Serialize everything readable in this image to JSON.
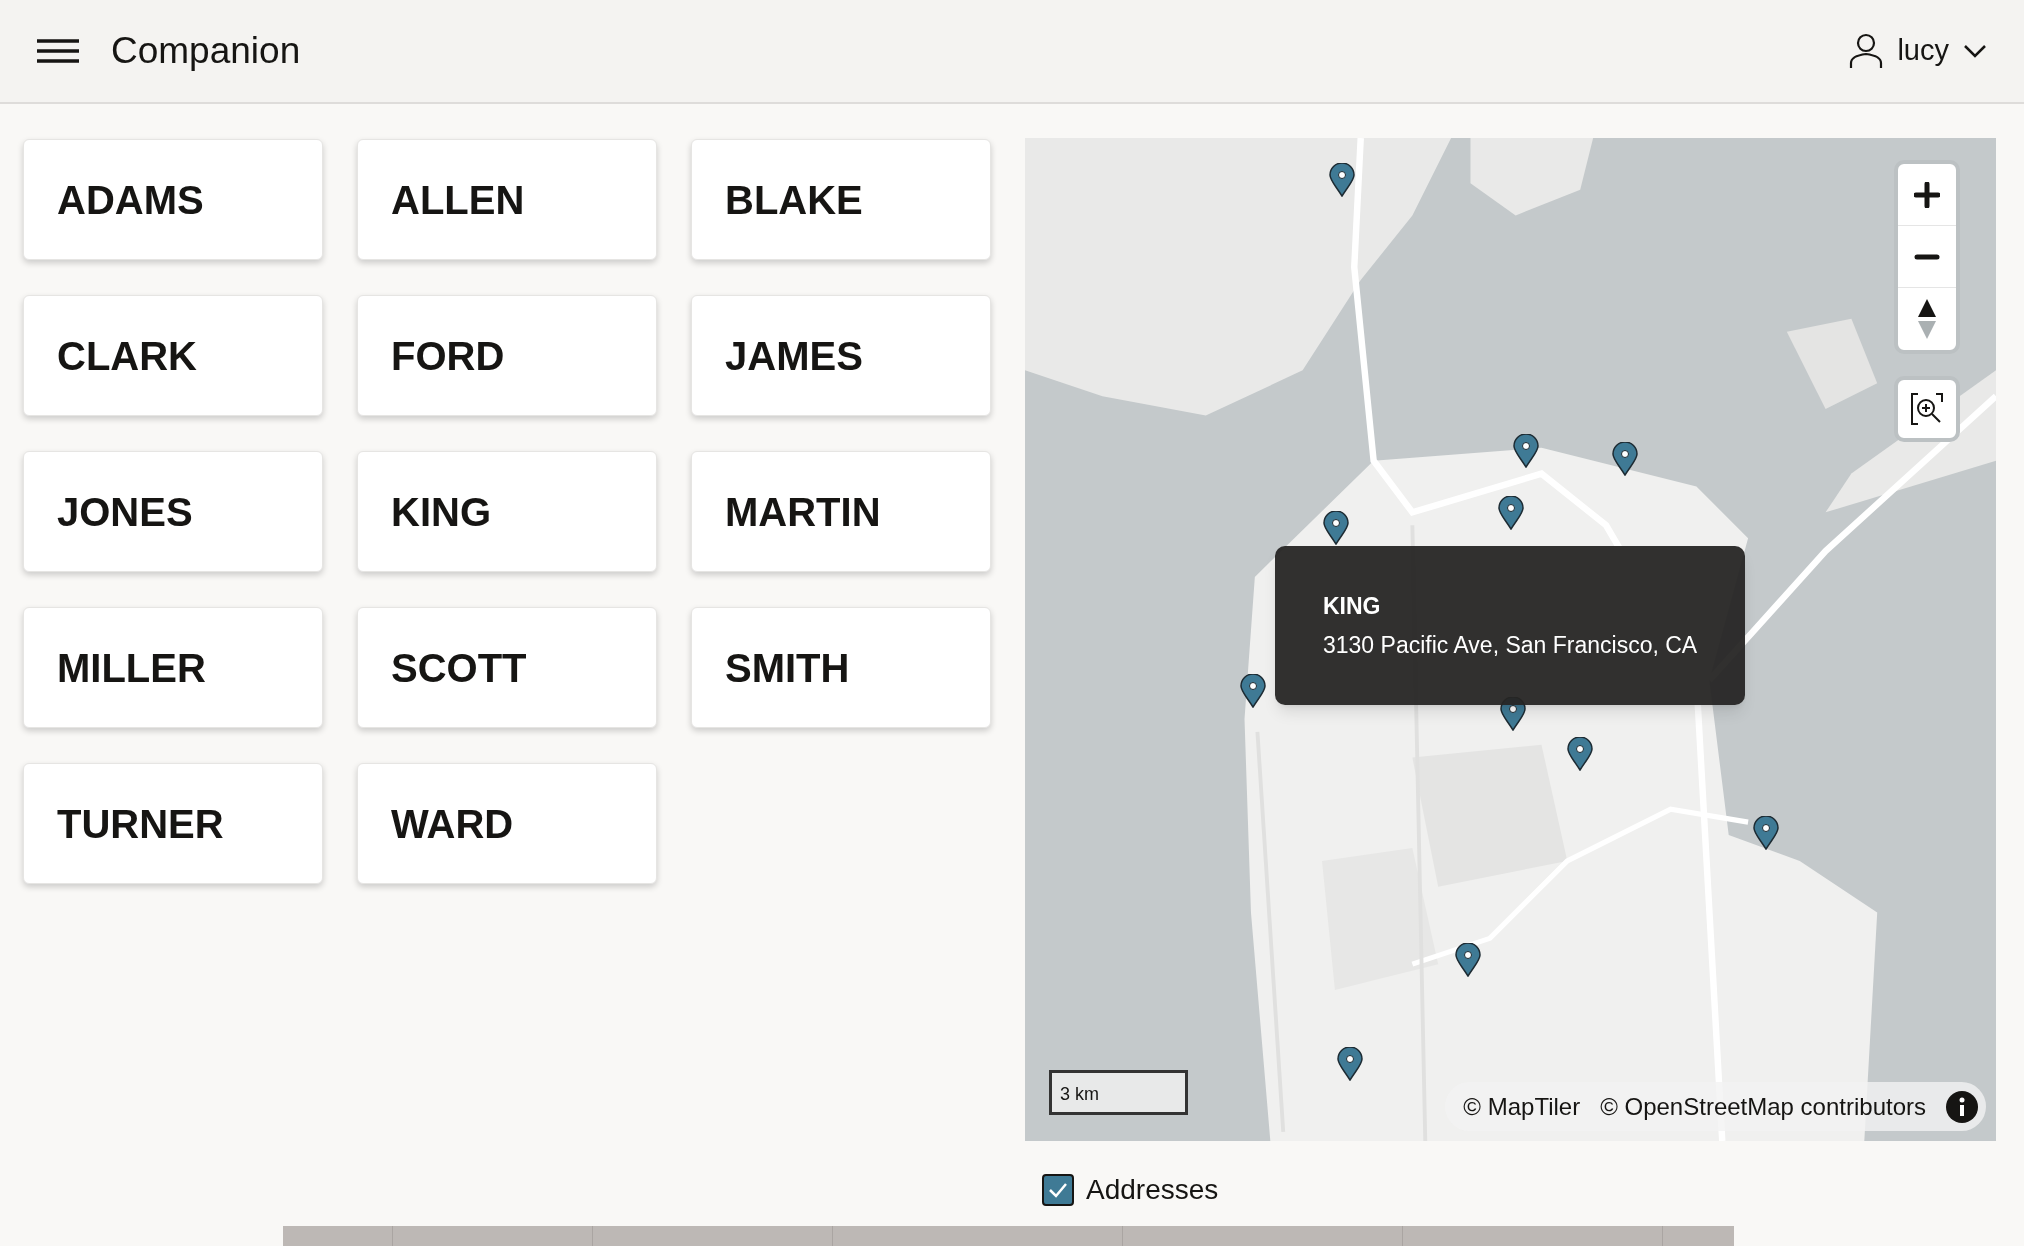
{
  "header": {
    "title": "Companion",
    "user": "lucy"
  },
  "cards": [
    "ADAMS",
    "ALLEN",
    "BLAKE",
    "CLARK",
    "FORD",
    "JAMES",
    "JONES",
    "KING",
    "MARTIN",
    "MILLER",
    "SCOTT",
    "SMITH",
    "TURNER",
    "WARD"
  ],
  "map": {
    "scale": "3 km",
    "attribution": [
      "© MapTiler",
      "© OpenStreetMap contributors"
    ],
    "popup": {
      "title": "KING",
      "address": "3130 Pacific Ave, San Francisco, CA"
    }
  },
  "addresses": {
    "label": "Addresses",
    "checked": true
  }
}
